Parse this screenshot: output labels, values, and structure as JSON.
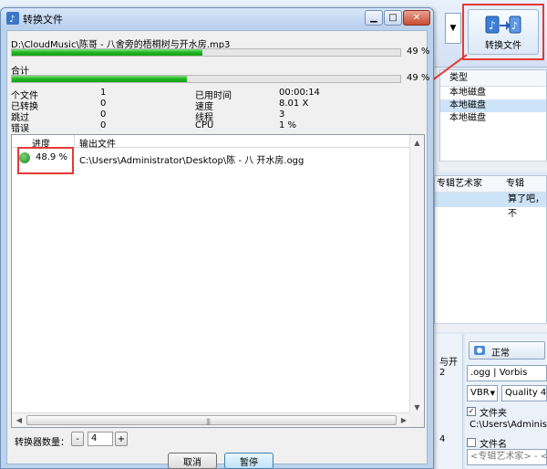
{
  "dialog": {
    "title": "转换文件",
    "window_buttons": {
      "minimize": "▁",
      "maximize": "□",
      "close": "✕"
    },
    "current_file": {
      "path": "D:\\CloudMusic\\陈哥 - 八舍旁的梧桐树与开水房.mp3",
      "percent_text": "49 %",
      "progress": 0.49
    },
    "total": {
      "label": "合计",
      "percent_text": "49 %",
      "progress": 0.45
    },
    "stats": {
      "files_label": "个文件",
      "files_value": "1",
      "converted_label": "已转换",
      "converted_value": "0",
      "skipped_label": "跳过",
      "skipped_value": "0",
      "errors_label": "错误",
      "errors_value": "0",
      "elapsed_label": "已用时间",
      "elapsed_value": "00:00:14",
      "speed_label": "速度",
      "speed_value": "8.01 X",
      "threads_label": "线程",
      "threads_value": "3",
      "cpu_label": "CPU",
      "cpu_value": "1 %"
    },
    "list": {
      "col_progress": "进度",
      "col_output": "输出文件",
      "rows": [
        {
          "progress_text": "48.9 %",
          "output_path": "C:\\Users\\Administrator\\Desktop\\陈  - 八      开水房.ogg"
        }
      ]
    },
    "converter_count": {
      "label": "转换器数量：",
      "minus": "-",
      "plus": "+",
      "value": "4"
    },
    "buttons": {
      "cancel": "取消",
      "pause": "暂停"
    }
  },
  "background": {
    "convert_button_label": "转换文件",
    "dropdown_arrow": "▼",
    "drive_panel": {
      "header": "类型",
      "rows": [
        "本地磁盘",
        "本地磁盘",
        "本地磁盘"
      ]
    },
    "track_panel": {
      "col_album_artist": "专辑艺术家",
      "col_album": "专辑",
      "row_album": "算了吧，不"
    },
    "side_text": "与开2",
    "side_text2": "4",
    "encoder": {
      "mode": "正常",
      "format": ".ogg | Vorbis",
      "bitrate_mode": "VBR",
      "quality": "Quality 4",
      "folder_label": "文件夹",
      "folder_path": "C:\\Users\\Administrator",
      "filename_label": "文件名",
      "filename_pattern": "<专辑艺术家> - <专辑"
    }
  },
  "colors": {
    "progress_green": "#1fb41f",
    "highlight_red": "#e53935",
    "selection_blue": "#cde3f7"
  }
}
